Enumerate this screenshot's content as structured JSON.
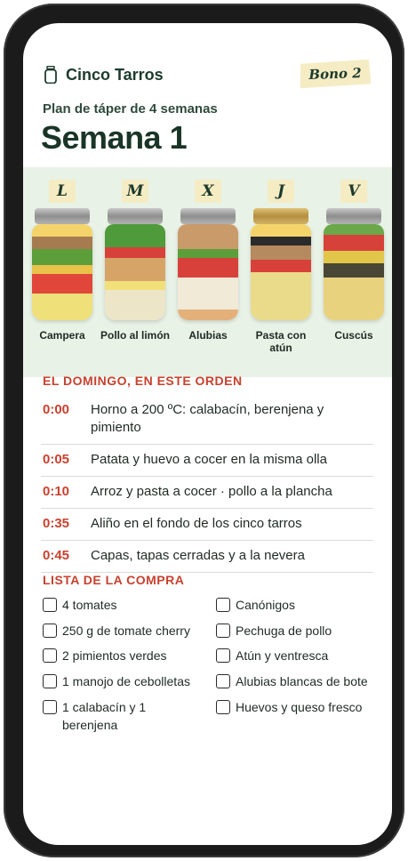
{
  "header": {
    "brand": "Cinco Tarros",
    "badge": "Bono 2"
  },
  "plan": {
    "subtitle": "Plan de táper de 4 semanas",
    "week_title": "Semana 1"
  },
  "jars": [
    {
      "day": "L",
      "name": "Campera"
    },
    {
      "day": "M",
      "name": "Pollo al limón"
    },
    {
      "day": "X",
      "name": "Alubias"
    },
    {
      "day": "J",
      "name": "Pasta con atún"
    },
    {
      "day": "V",
      "name": "Cuscús"
    }
  ],
  "sunday": {
    "title": "EL DOMINGO, EN ESTE ORDEN",
    "steps": [
      {
        "time": "0:00",
        "text": "Horno a 200 ºC: calabacín, berenjena y pimiento"
      },
      {
        "time": "0:05",
        "text": "Patata y huevo a cocer en la misma olla"
      },
      {
        "time": "0:10",
        "text": "Arroz y pasta a cocer · pollo a la plancha"
      },
      {
        "time": "0:35",
        "text": "Aliño en el fondo de los cinco tarros"
      },
      {
        "time": "0:45",
        "text": "Capas, tapas cerradas y a la nevera"
      }
    ]
  },
  "shopping": {
    "title": "LISTA DE LA COMPRA",
    "items": [
      "4 tomates",
      "Canónigos",
      "250 g de tomate cherry",
      "Pechuga de pollo",
      "2 pimientos verdes",
      "Atún y ventresca",
      "1 manojo de cebolletas",
      "Alubias blancas de bote",
      "1 calabacín y 1 berenjena",
      "Huevos y queso fresco"
    ]
  },
  "colors": {
    "accent": "#c8412f",
    "brand_dark": "#1a3527",
    "band": "#e8f2e6",
    "badge": "#f5ecc4"
  }
}
